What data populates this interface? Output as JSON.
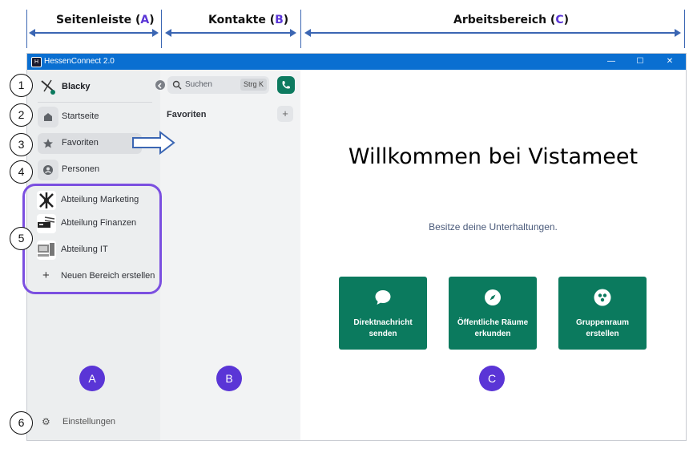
{
  "annotations": {
    "sidebar_header": {
      "prefix": "Seitenleiste (",
      "letter": "A",
      "suffix": ")"
    },
    "contacts_header": {
      "prefix": "Kontakte (",
      "letter": "B",
      "suffix": ")"
    },
    "workspace_header": {
      "prefix": "Arbeitsbereich (",
      "letter": "C",
      "suffix": ")"
    },
    "numbers": [
      "1",
      "2",
      "3",
      "4",
      "5",
      "6"
    ],
    "badges": [
      "A",
      "B",
      "C"
    ],
    "accent_color": "#5a35d6"
  },
  "window": {
    "title": "HessenConnect 2.0",
    "controls": {
      "minimize": "—",
      "maximize": "☐",
      "close": "✕"
    },
    "titlebar_color": "#0a6fd1"
  },
  "sidebar": {
    "user_name": "Blacky",
    "nav": [
      {
        "label": "Startseite",
        "icon": "home-icon"
      },
      {
        "label": "Favoriten",
        "icon": "star-icon"
      },
      {
        "label": "Personen",
        "icon": "person-icon"
      }
    ],
    "spaces": [
      {
        "label": "Abteilung Marketing"
      },
      {
        "label": "Abteilung Finanzen"
      },
      {
        "label": "Abteilung IT"
      }
    ],
    "create_space": {
      "icon": "+",
      "label": "Neuen Bereich erstellen"
    },
    "settings_label": "Einstellungen"
  },
  "contacts": {
    "search_placeholder": "Suchen",
    "search_shortcut": "Strg K",
    "favorites_heading": "Favoriten",
    "add_icon": "+"
  },
  "workspace": {
    "heading": "Willkommen bei Vistameet",
    "subheading": "Besitze deine Unterhaltungen.",
    "tiles": [
      {
        "label": "Direktnachricht senden",
        "icon": "chat-bubble-icon"
      },
      {
        "label": "Öffentliche Räume erkunden",
        "icon": "compass-icon"
      },
      {
        "label": "Gruppenraum erstellen",
        "icon": "group-icon"
      }
    ],
    "tile_color": "#0b7a5e"
  }
}
